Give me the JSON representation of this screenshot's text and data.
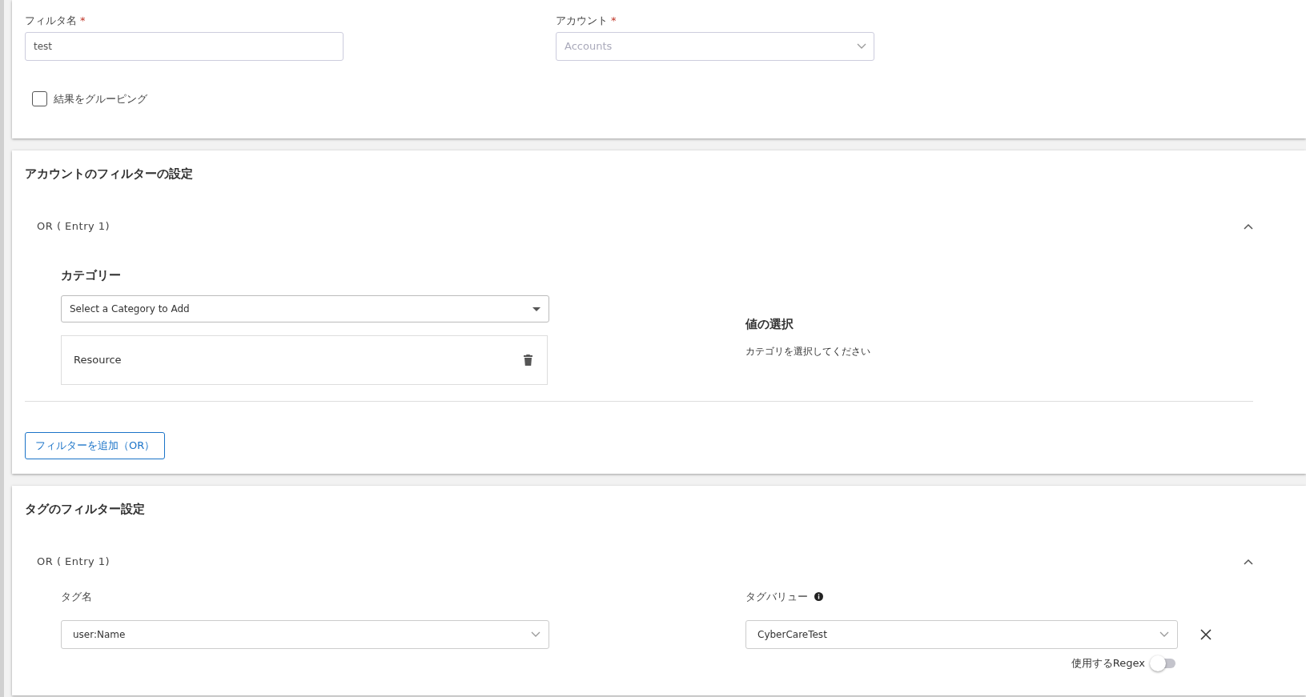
{
  "general": {
    "filter_name": {
      "label": "フィルタ名",
      "required_mark": "*",
      "value": "test"
    },
    "account": {
      "label": "アカウント",
      "required_mark": "*",
      "placeholder": "Accounts"
    },
    "group_results": {
      "label": "結果をグルーピング",
      "checked": false
    }
  },
  "account_filter": {
    "title": "アカウントのフィルターの設定",
    "entries": [
      {
        "label": "OR ( Entry 1)",
        "expanded": true,
        "category_label": "カテゴリー",
        "category_placeholder": "Select a Category to Add",
        "categories": [
          {
            "name": "Resource"
          }
        ],
        "value_label": "値の選択",
        "value_hint": "カテゴリを選択してください"
      }
    ],
    "add_button": "フィルターを追加（OR）"
  },
  "tag_filter": {
    "title": "タグのフィルター設定",
    "entries": [
      {
        "label": "OR ( Entry 1)",
        "expanded": true,
        "tag_name_label": "タグ名",
        "tag_name": "user:Name",
        "tag_value_label": "タグバリュー",
        "tag_value": "CyberCareTest",
        "regex_label": "使用するRegex",
        "regex_on": false
      }
    ]
  }
}
